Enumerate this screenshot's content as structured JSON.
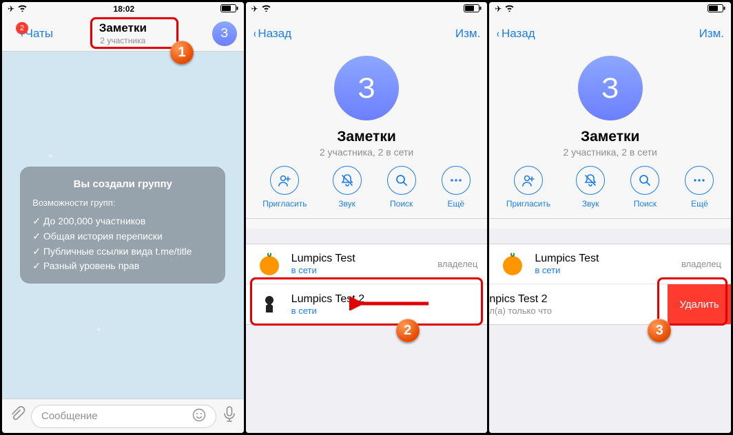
{
  "status": {
    "time": "18:02"
  },
  "screen1": {
    "back_label": "Чаты",
    "back_badge": "2",
    "title": "Заметки",
    "subtitle": "2 участника",
    "avatar_letter": "З",
    "bubble_title": "Вы создали группу",
    "bubble_sub": "Возможности групп:",
    "bubble_items": [
      "До 200,000 участников",
      "Общая история переписки",
      "Публичные ссылки вида t.me/title",
      "Разный уровень прав"
    ],
    "composer_placeholder": "Сообщение"
  },
  "screen2": {
    "back_label": "Назад",
    "edit_label": "Изм.",
    "avatar_letter": "З",
    "name": "Заметки",
    "subtitle": "2 участника, 2 в сети",
    "actions": {
      "invite": "Пригласить",
      "sound": "Звук",
      "search": "Поиск",
      "more": "Ещё"
    },
    "members": [
      {
        "name": "Lumpics Test",
        "status": "в сети",
        "role": "владелец",
        "avatar": "orange"
      },
      {
        "name": "Lumpics Test 2",
        "status": "в сети",
        "role": "",
        "avatar": "silhouette"
      }
    ]
  },
  "screen3": {
    "back_label": "Назад",
    "edit_label": "Изм.",
    "avatar_letter": "З",
    "name": "Заметки",
    "subtitle": "2 участника, 2 в сети",
    "actions": {
      "invite": "Пригласить",
      "sound": "Звук",
      "search": "Поиск",
      "more": "Ещё"
    },
    "members": [
      {
        "name": "Lumpics Test",
        "status": "в сети",
        "role": "владелец",
        "avatar": "orange"
      },
      {
        "name_partial": "npics Test 2",
        "status": "л(а) только что",
        "role": "",
        "avatar": "silhouette"
      }
    ],
    "delete_label": "Удалить"
  },
  "callouts": {
    "n1": "1",
    "n2": "2",
    "n3": "3"
  }
}
